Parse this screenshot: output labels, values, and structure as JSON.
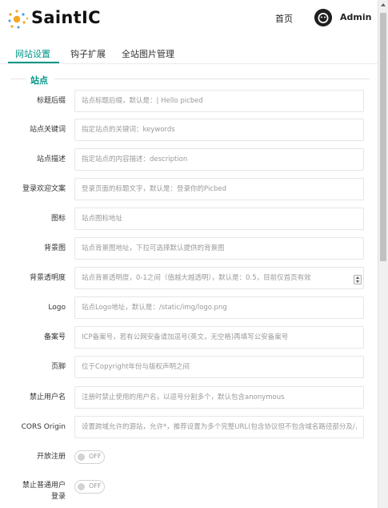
{
  "header": {
    "logo_text": "SaintIC",
    "nav_home": "首页",
    "user_name": "Admin"
  },
  "tabs": [
    {
      "label": "网站设置",
      "active": true
    },
    {
      "label": "钩子扩展",
      "active": false
    },
    {
      "label": "全站图片管理",
      "active": false
    }
  ],
  "section": {
    "legend": "站点"
  },
  "fields": [
    {
      "label": "标题后缀",
      "placeholder": "站点标题后缀，默认是：| Hello picbed"
    },
    {
      "label": "站点关键词",
      "placeholder": "指定站点的关键词：keywords"
    },
    {
      "label": "站点描述",
      "placeholder": "指定站点的内容描述：description"
    },
    {
      "label": "登录欢迎文案",
      "placeholder": "登录页面的标题文字，默认是：登录你的Picbed"
    },
    {
      "label": "图标",
      "placeholder": "站点图标地址"
    },
    {
      "label": "背景图",
      "placeholder": "站点背景图地址，下拉可选择默认提供的背景图"
    },
    {
      "label": "背景透明度",
      "placeholder": "站点背景透明度，0-1之间（值越大越透明），默认是：0.5，目前仅首页有效"
    },
    {
      "label": "Logo",
      "placeholder": "站点Logo地址，默认是：/static/img/logo.png"
    },
    {
      "label": "备案号",
      "placeholder": "ICP备案号，若有公网安备请加逗号(英文，无空格)再填写公安备案号"
    },
    {
      "label": "页脚",
      "placeholder": "位于Copyright年份与版权声明之间"
    },
    {
      "label": "禁止用户名",
      "placeholder": "注册时禁止使用的用户名，以逗号分割多个，默认包含anonymous"
    },
    {
      "label": "CORS Origin",
      "placeholder": "设置跨域允许的源站，允许*，推荐设置为多个完整URL(包含协议但不包含域名路径部分及/，多"
    }
  ],
  "toggles": [
    {
      "label": "开放注册",
      "state_text": "OFF",
      "value": false
    },
    {
      "label_line1": "禁止普通用户",
      "label_line2": "登录",
      "state_text": "OFF",
      "value": false
    }
  ],
  "colors": {
    "accent": "#009688",
    "logo_orange": "#f5a623",
    "logo_blue": "#3aa0e8"
  }
}
